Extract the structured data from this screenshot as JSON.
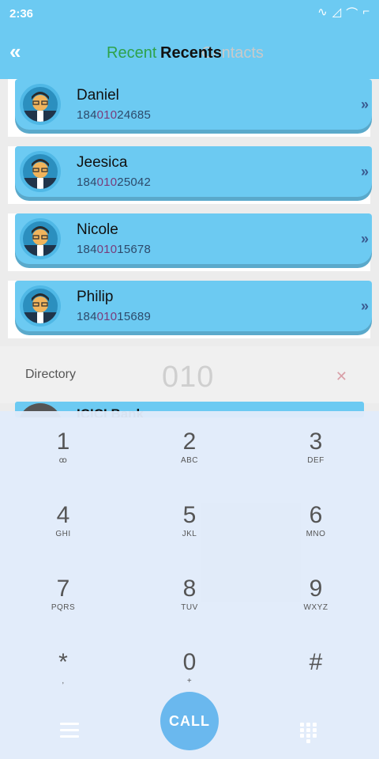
{
  "status": {
    "time": "2:36"
  },
  "header": {
    "tab_recents_ghost": "Recent",
    "tab_contacts": "Contacts",
    "tab_recents": "Recents"
  },
  "contacts": [
    {
      "name": "Daniel",
      "number_pre": "184",
      "number_hl": "010",
      "number_post": "24685"
    },
    {
      "name": "Jeesica",
      "number_pre": "184",
      "number_hl": "010",
      "number_post": "25042"
    },
    {
      "name": "Nicole",
      "number_pre": "184",
      "number_hl": "010",
      "number_post": "15678"
    },
    {
      "name": "Philip",
      "number_pre": "184",
      "number_hl": "010",
      "number_post": "15689"
    }
  ],
  "directory": {
    "label": "Directory",
    "input_value": "010"
  },
  "peek": {
    "text": "ICICI Bank"
  },
  "keys": [
    {
      "digit": "1",
      "letters": "ꝏ"
    },
    {
      "digit": "2",
      "letters": "ABC"
    },
    {
      "digit": "3",
      "letters": "DEF"
    },
    {
      "digit": "4",
      "letters": "GHI"
    },
    {
      "digit": "5",
      "letters": "JKL"
    },
    {
      "digit": "6",
      "letters": "MNO"
    },
    {
      "digit": "7",
      "letters": "PQRS"
    },
    {
      "digit": "8",
      "letters": "TUV"
    },
    {
      "digit": "9",
      "letters": "WXYZ"
    },
    {
      "digit": "*",
      "letters": ","
    },
    {
      "digit": "0",
      "letters": "+"
    },
    {
      "digit": "#",
      "letters": ""
    }
  ],
  "call_label": "CALL",
  "icons": {
    "back": "double-chevron-left-icon",
    "arrow": "double-chevron-right-icon",
    "clear": "close-icon",
    "menu": "menu-icon",
    "keypad": "keypad-icon"
  }
}
